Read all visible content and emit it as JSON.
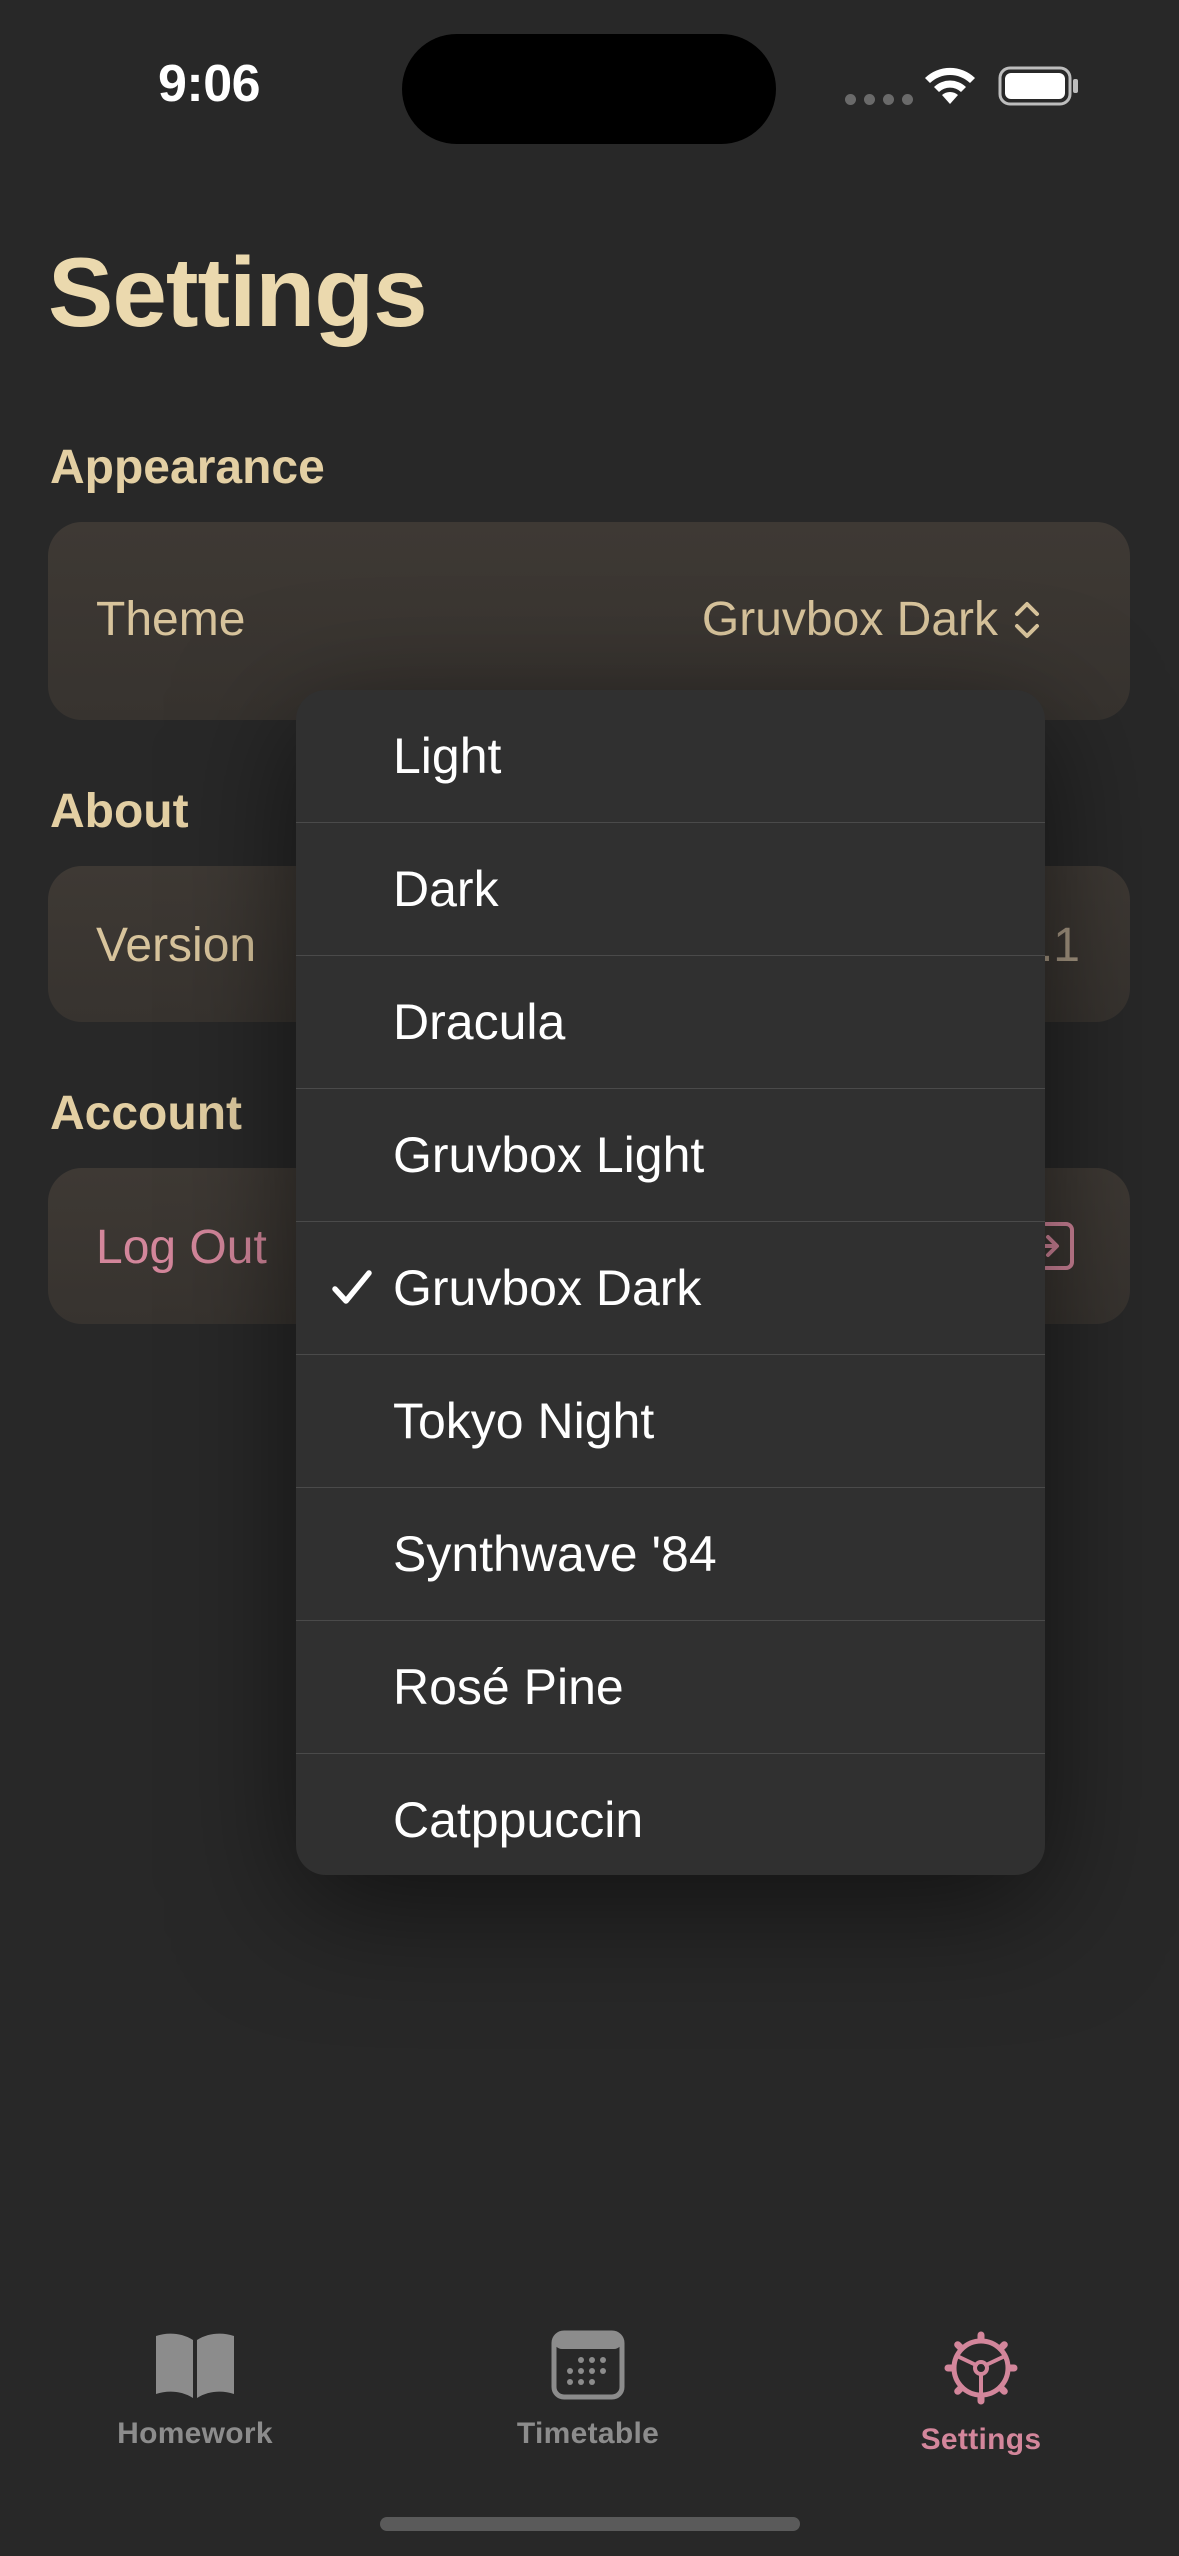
{
  "status_bar": {
    "time": "9:06"
  },
  "page": {
    "title": "Settings"
  },
  "sections": {
    "appearance": {
      "title": "Appearance",
      "theme_label": "Theme",
      "theme_value": "Gruvbox Dark"
    },
    "about": {
      "title": "About",
      "version_label": "Version",
      "version_value": ".1"
    },
    "account": {
      "title": "Account",
      "logout_label": "Log Out"
    }
  },
  "theme_menu": {
    "selected": "Gruvbox Dark",
    "items": [
      {
        "label": "Light"
      },
      {
        "label": "Dark"
      },
      {
        "label": "Dracula"
      },
      {
        "label": "Gruvbox Light"
      },
      {
        "label": "Gruvbox Dark"
      },
      {
        "label": "Tokyo Night"
      },
      {
        "label": "Synthwave '84"
      },
      {
        "label": "Rosé Pine"
      },
      {
        "label": "Catppuccin"
      }
    ]
  },
  "tabbar": {
    "tabs": [
      {
        "label": "Homework",
        "icon": "book-icon"
      },
      {
        "label": "Timetable",
        "icon": "calendar-icon"
      },
      {
        "label": "Settings",
        "icon": "gear-icon"
      }
    ],
    "active": "Settings"
  },
  "colors": {
    "background": "#282828",
    "accent": "#d3869b",
    "title": "#ebd9ae",
    "menu_background": "#303030"
  }
}
